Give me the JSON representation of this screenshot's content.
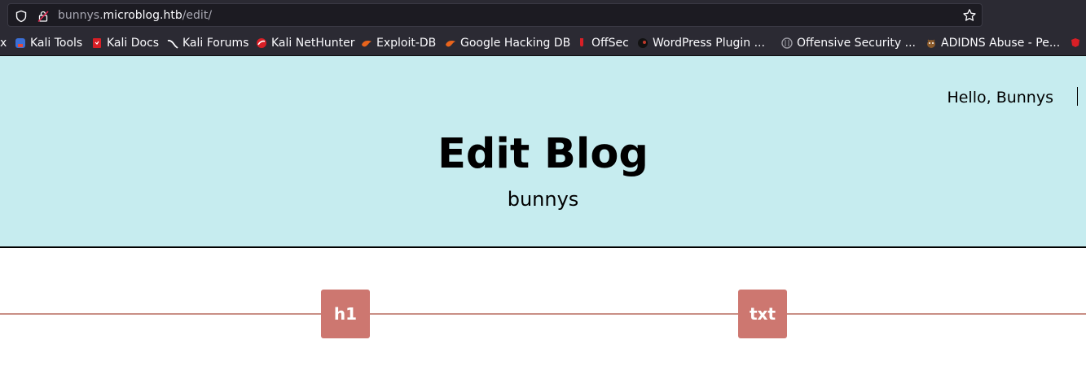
{
  "browser": {
    "url_subdomain": "bunnys.",
    "url_host": "microblog.htb",
    "url_path": "/edit/",
    "bookmarks": [
      {
        "label": "x",
        "icon": "truncated-bookmark"
      },
      {
        "label": "Kali Tools",
        "icon": "kali-tools-icon"
      },
      {
        "label": "Kali Docs",
        "icon": "kali-docs-icon"
      },
      {
        "label": "Kali Forums",
        "icon": "kali-forums-icon"
      },
      {
        "label": "Kali NetHunter",
        "icon": "kali-nethunter-icon"
      },
      {
        "label": "Exploit-DB",
        "icon": "exploit-db-icon"
      },
      {
        "label": "Google Hacking DB",
        "icon": "ghdb-icon"
      },
      {
        "label": "OffSec",
        "icon": "offsec-icon"
      },
      {
        "label": "WordPress Plugin ...",
        "icon": "wordpress-plugin-icon"
      },
      {
        "label": "Offensive Security ...",
        "icon": "offensive-security-icon"
      },
      {
        "label": "ADIDNS Abuse - Pe...",
        "icon": "adidns-icon"
      }
    ]
  },
  "page": {
    "greeting": "Hello, Bunnys",
    "title": "Edit Blog",
    "subtitle": "bunnys"
  },
  "toolbar": {
    "h1_label": "h1",
    "txt_label": "txt"
  },
  "colors": {
    "hero_bg": "#c6ecef",
    "button_bg": "#cd7770",
    "line": "#c98f86"
  }
}
